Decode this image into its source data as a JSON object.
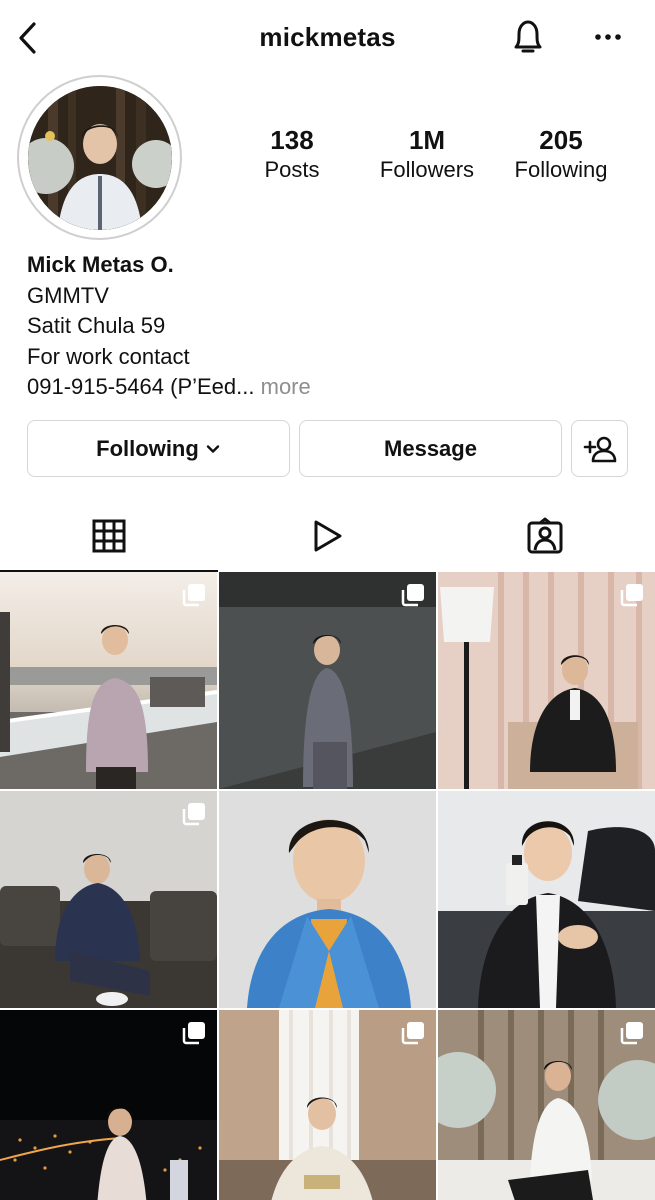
{
  "header": {
    "username": "mickmetas",
    "icons": {
      "back": "chevron-left-icon",
      "bell": "bell-icon",
      "more": "more-horizontal-icon"
    }
  },
  "profile": {
    "stats": [
      {
        "value": "138",
        "label": "Posts"
      },
      {
        "value": "1M",
        "label": "Followers"
      },
      {
        "value": "205",
        "label": "Following"
      }
    ],
    "bio": {
      "name": "Mick Metas O.",
      "lines": [
        "GMMTV",
        "Satit Chula 59",
        "For work contact"
      ],
      "last_line": "091-915-5464 (P’Eed...",
      "more": " more"
    }
  },
  "actions": {
    "following": "Following",
    "message": "Message",
    "add_friend_icon": "add-user-icon"
  },
  "tabs": [
    {
      "name": "posts-grid-icon",
      "active": true
    },
    {
      "name": "reels-icon",
      "active": false
    },
    {
      "name": "tagged-icon",
      "active": false
    }
  ],
  "posts": [
    {
      "scene": "pier-sunset",
      "multi": true
    },
    {
      "scene": "gray-wall",
      "multi": true
    },
    {
      "scene": "tuxedo-room",
      "multi": true
    },
    {
      "scene": "leather-sofa",
      "multi": true
    },
    {
      "scene": "blue-jacket-portrait",
      "multi": false
    },
    {
      "scene": "perfume-suit",
      "multi": false
    },
    {
      "scene": "night-city",
      "multi": true
    },
    {
      "scene": "window-sweater",
      "multi": true
    },
    {
      "scene": "snowy-trees",
      "multi": true
    }
  ],
  "colors": {
    "border": "#d6d6d6",
    "secondary_text": "#8e8e8e",
    "text": "#111111"
  }
}
